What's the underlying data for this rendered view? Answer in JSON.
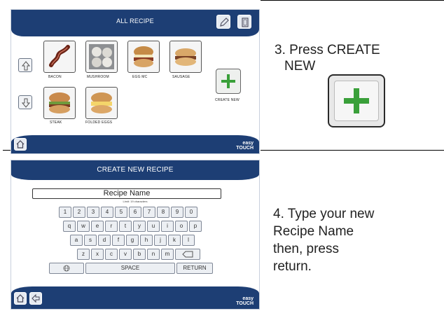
{
  "screen1": {
    "title": "ALL RECIPE",
    "recipes": [
      {
        "label": "BACON"
      },
      {
        "label": "MUSHROOM"
      },
      {
        "label": "EGG MC"
      },
      {
        "label": "SAUSAGE"
      },
      {
        "label": "STEAK"
      },
      {
        "label": "FOLDED EGGS"
      }
    ],
    "create_new_label": "CREATE NEW",
    "brand_line1": "easy",
    "brand_line2": "TOUCH"
  },
  "screen2": {
    "title": "CREATE NEW RECIPE",
    "recipe_name": "Recipe Name",
    "limit": "Limit: 19 characters",
    "keys_row1": [
      "1",
      "2",
      "3",
      "4",
      "5",
      "6",
      "7",
      "8",
      "9",
      "0"
    ],
    "keys_row2": [
      "q",
      "w",
      "e",
      "r",
      "t",
      "y",
      "u",
      "i",
      "o",
      "p"
    ],
    "keys_row3": [
      "a",
      "s",
      "d",
      "f",
      "g",
      "h",
      "j",
      "k",
      "l"
    ],
    "keys_row4": [
      "z",
      "x",
      "c",
      "v",
      "b",
      "n",
      "m"
    ],
    "space_label": "SPACE",
    "return_label": "RETURN",
    "brand_line1": "easy",
    "brand_line2": "TOUCH"
  },
  "instructions": {
    "step3_line1": "3. Press CREATE",
    "step3_line2": "NEW",
    "step4_line1": "4. Type your new",
    "step4_line2": "Recipe Name",
    "step4_line3": "then, press",
    "step4_line4": "return."
  },
  "colors": {
    "bar": "#1d3e74",
    "plus": "#3aa03a"
  }
}
